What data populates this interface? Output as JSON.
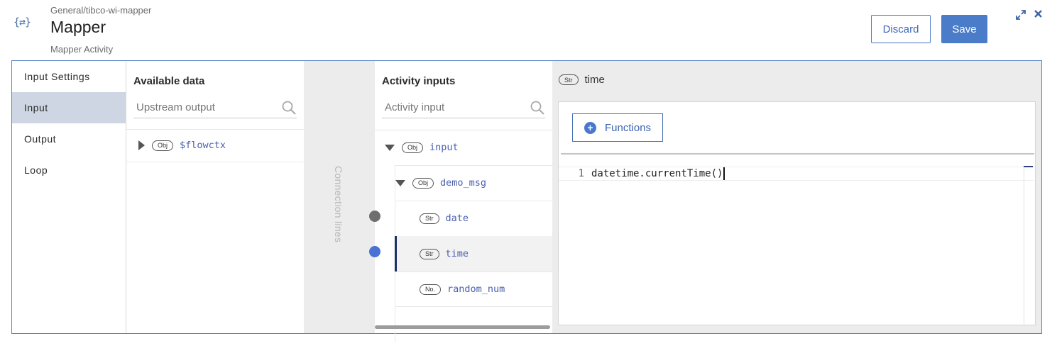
{
  "header": {
    "app_icon": "{⇄}",
    "breadcrumb": "General/tibco-wi-mapper",
    "title": "Mapper",
    "subtitle": "Mapper Activity",
    "discard_label": "Discard",
    "save_label": "Save",
    "expand_icon": "expand-arrows-icon",
    "close_icon": "close-icon"
  },
  "nav": {
    "items": [
      {
        "label": "Input Settings",
        "active": false
      },
      {
        "label": "Input",
        "active": true
      },
      {
        "label": "Output",
        "active": false
      },
      {
        "label": "Loop",
        "active": false
      }
    ]
  },
  "available": {
    "heading": "Available data",
    "search_placeholder": "Upstream output",
    "items": [
      {
        "type": "Obj",
        "label": "$flowctx",
        "expanded": false
      }
    ]
  },
  "connection": {
    "label": "Connection lines",
    "dot_unmapped_color": "#6e6e6e",
    "dot_mapped_color": "#4a72d4"
  },
  "inputs": {
    "heading": "Activity inputs",
    "search_placeholder": "Activity input",
    "tree": [
      {
        "type": "Obj",
        "label": "input"
      },
      {
        "type": "Obj",
        "label": "demo_msg"
      },
      {
        "type": "Str",
        "label": "date"
      },
      {
        "type": "Str",
        "label": "time",
        "selected": true
      },
      {
        "type": "No.",
        "label": "random_num"
      }
    ]
  },
  "editor": {
    "field_type": "Str",
    "field_name": "time",
    "functions_label": "Functions",
    "line_number": "1",
    "code": "datetime.currentTime()"
  },
  "colors": {
    "accent": "#4a7cc9",
    "selected_row_marker": "#1f2d6e",
    "active_nav_bg": "#cfd6e3"
  }
}
